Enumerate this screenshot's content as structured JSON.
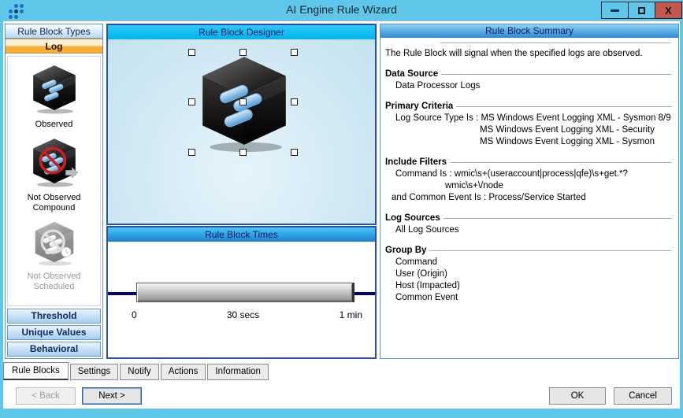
{
  "window": {
    "title": "AI Engine Rule Wizard",
    "close_glyph": "X",
    "accent_color": "#5fc8ea",
    "close_color": "#c4584e"
  },
  "left_panel": {
    "header": "Rule Block Types",
    "selected_category": "Log",
    "items": [
      {
        "label": "Observed",
        "icon": "observed-cube-icon",
        "enabled": true
      },
      {
        "label": "Not Observed Compound",
        "icon": "not-observed-compound-icon",
        "enabled": true
      },
      {
        "label": "Not Observed Scheduled",
        "icon": "not-observed-scheduled-icon",
        "enabled": false
      }
    ],
    "categories": [
      {
        "label": "Threshold"
      },
      {
        "label": "Unique Values"
      },
      {
        "label": "Behavioral"
      }
    ]
  },
  "designer": {
    "header": "Rule Block Designer",
    "block_icon": "rule-block-cube-icon"
  },
  "times": {
    "header": "Rule Block Times",
    "tick_start": "0",
    "tick_mid": "30 secs",
    "tick_end": "1 min"
  },
  "summary": {
    "header": "Rule Block Summary",
    "intro": "The Rule Block will signal when the specified logs are observed.",
    "sections": [
      {
        "title": "Data Source",
        "lines": [
          "Data Processor Logs"
        ]
      },
      {
        "title": "Primary Criteria",
        "lines": [
          "Log Source Type Is : MS Windows Event Logging XML - Sysmon 8/9",
          "MS Windows Event Logging XML - Security",
          "MS Windows Event Logging XML - Sysmon"
        ]
      },
      {
        "title": "Include Filters",
        "lines": [
          "Command Is : wmic\\s+(useraccount|process|qfe)\\s+get.*?",
          "wmic\\s+\\/node",
          "and Common Event Is : Process/Service Started"
        ]
      },
      {
        "title": "Log Sources",
        "lines": [
          "All Log Sources"
        ]
      },
      {
        "title": "Group By",
        "lines": [
          "Command",
          "User (Origin)",
          "Host (Impacted)",
          "Common Event"
        ]
      }
    ]
  },
  "tabs": [
    {
      "label": "Rule Blocks",
      "active": true
    },
    {
      "label": "Settings",
      "active": false
    },
    {
      "label": "Notify",
      "active": false
    },
    {
      "label": "Actions",
      "active": false
    },
    {
      "label": "Information",
      "active": false
    }
  ],
  "footer": {
    "back": "< Back",
    "next": "Next >",
    "ok": "OK",
    "cancel": "Cancel"
  }
}
